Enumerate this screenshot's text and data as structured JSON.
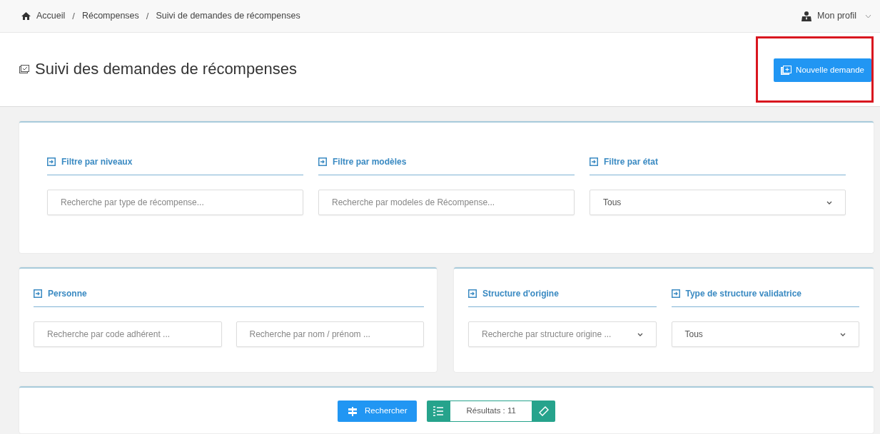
{
  "breadcrumb": [
    {
      "label": "Accueil"
    },
    {
      "label": "Récompenses"
    },
    {
      "label": "Suivi de demandes de récompenses"
    }
  ],
  "breadcrumb_separator": "/",
  "profile": {
    "label": "Mon profil"
  },
  "page_title": "Suivi des demandes de récompenses",
  "new_button": {
    "label": "Nouvelle demande",
    "highlighted": true
  },
  "filter_card": {
    "fields": [
      {
        "heading": "Filtre par niveaux",
        "kind": "input",
        "placeholder": "Recherche par type de récompense..."
      },
      {
        "heading": "Filtre par modèles",
        "kind": "input",
        "placeholder": "Recherche par modeles de Récompense..."
      },
      {
        "heading": "Filtre par état",
        "kind": "select",
        "value": "Tous"
      }
    ]
  },
  "person_card": {
    "heading": "Personne",
    "fields": [
      {
        "kind": "input",
        "placeholder": "Recherche par code adhérent ..."
      },
      {
        "kind": "input",
        "placeholder": "Recherche par nom / prénom ..."
      }
    ]
  },
  "structure_card": {
    "fields": [
      {
        "heading": "Structure d'origine",
        "kind": "select",
        "placeholder": "Recherche par structure origine ..."
      },
      {
        "heading": "Type de structure validatrice",
        "kind": "select",
        "value": "Tous"
      }
    ]
  },
  "actions": {
    "search_button": "Rechercher",
    "results": "Résultats : 11"
  }
}
